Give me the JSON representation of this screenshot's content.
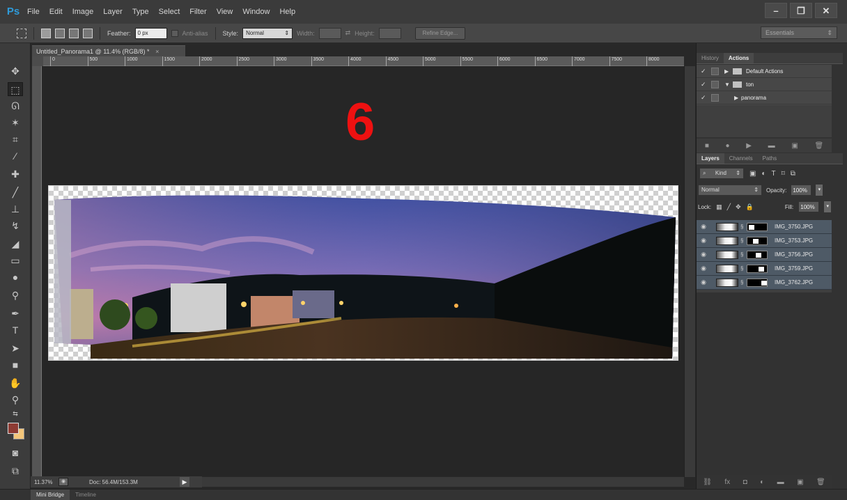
{
  "app": {
    "logo": "Ps"
  },
  "menu": [
    "File",
    "Edit",
    "Image",
    "Layer",
    "Type",
    "Select",
    "Filter",
    "View",
    "Window",
    "Help"
  ],
  "window_controls": {
    "minimize": "–",
    "restore": "❐",
    "close": "✕"
  },
  "options_bar": {
    "feather_label": "Feather:",
    "feather_value": "0 px",
    "anti_alias_label": "Anti-alias",
    "style_label": "Style:",
    "style_value": "Normal",
    "width_label": "Width:",
    "height_label": "Height:",
    "refine_edge_label": "Refine Edge...",
    "workspace": "Essentials"
  },
  "document": {
    "tab_title": "Untitled_Panorama1 @ 11.4% (RGB/8) *",
    "tab_close": "×",
    "ruler_labels": [
      "0",
      "500",
      "1000",
      "1500",
      "2000",
      "2500",
      "3000",
      "3500",
      "4000",
      "4500",
      "5000",
      "5500",
      "6000",
      "6500",
      "7000",
      "7500",
      "8000"
    ],
    "step_number": "6"
  },
  "status": {
    "zoom": "11.37%",
    "doc_size": "Doc: 56.4M/153.3M"
  },
  "bottom_tabs": [
    "Mini Bridge",
    "Timeline"
  ],
  "actions_panel": {
    "tabs": [
      "History",
      "Actions"
    ],
    "active_tab": "Actions",
    "items": [
      {
        "label": "Default Actions",
        "expanded": false,
        "indent": 0
      },
      {
        "label": "ton",
        "expanded": true,
        "indent": 0
      },
      {
        "label": "panorama",
        "expanded": false,
        "indent": 1
      }
    ]
  },
  "layers_panel": {
    "tabs": [
      "Layers",
      "Channels",
      "Paths"
    ],
    "active_tab": "Layers",
    "kind_label": "Kind",
    "blend_mode": "Normal",
    "opacity_label": "Opacity:",
    "opacity_value": "100%",
    "lock_label": "Lock:",
    "fill_label": "Fill:",
    "fill_value": "100%",
    "layers": [
      "IMG_3750.JPG",
      "IMG_3753.JPG",
      "IMG_3756.JPG",
      "IMG_3759.JPG",
      "IMG_3762.JPG"
    ]
  },
  "colors": {
    "foreground": "#8e3b33",
    "background": "#f4c77b",
    "accent": "#2f9bd9",
    "step_number": "#ee1111"
  }
}
